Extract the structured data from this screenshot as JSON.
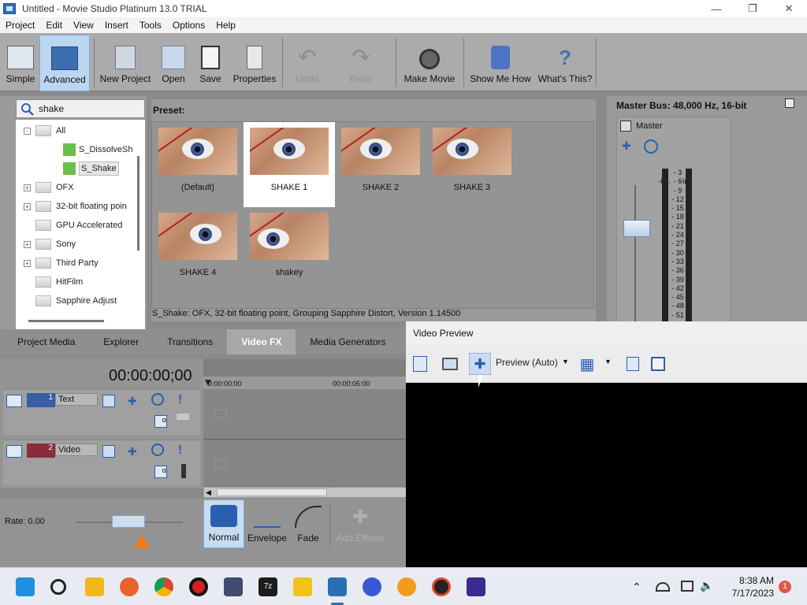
{
  "window": {
    "title": "Untitled - Movie Studio Platinum 13.0 TRIAL"
  },
  "menu": [
    "Project",
    "Edit",
    "View",
    "Insert",
    "Tools",
    "Options",
    "Help"
  ],
  "toolbar": {
    "simple": "Simple",
    "advanced": "Advanced",
    "new_project": "New Project",
    "open": "Open",
    "save": "Save",
    "properties": "Properties",
    "undo": "Undo",
    "redo": "Redo",
    "make_movie": "Make Movie",
    "show_me_how": "Show Me How",
    "whats_this": "What's This?"
  },
  "search": {
    "query": "shake"
  },
  "tree": {
    "items": [
      {
        "label": "All",
        "kind": "folder",
        "expand": "-"
      },
      {
        "label": "S_DissolveSh",
        "kind": "fx"
      },
      {
        "label": "S_Shake",
        "kind": "fx",
        "selected": true
      },
      {
        "label": "OFX",
        "kind": "folder",
        "expand": "+"
      },
      {
        "label": "32-bit floating poin",
        "kind": "folder",
        "expand": "+"
      },
      {
        "label": "GPU Accelerated",
        "kind": "folder"
      },
      {
        "label": "Sony",
        "kind": "folder",
        "expand": "+"
      },
      {
        "label": "Third Party",
        "kind": "folder",
        "expand": "+"
      },
      {
        "label": "HitFilm",
        "kind": "folder"
      },
      {
        "label": "Sapphire Adjust",
        "kind": "folder"
      }
    ]
  },
  "preset": {
    "title": "Preset:",
    "items": [
      "(Default)",
      "SHAKE 1",
      "SHAKE 2",
      "SHAKE 3",
      "SHAKE 4",
      "shakey"
    ],
    "selected": "SHAKE 1",
    "status": "S_Shake: OFX, 32-bit floating point, Grouping  Sapphire Distort, Version 1.14500"
  },
  "master": {
    "title": "Master Bus: 48,000 Hz, 16-bit",
    "channel": "Master",
    "peak_left": "-Inf.",
    "peak_right": "-Inf.",
    "scale": [
      "3",
      "6",
      "9",
      "12",
      "15",
      "18",
      "21",
      "24",
      "27",
      "30",
      "33",
      "36",
      "39",
      "42",
      "45",
      "48",
      "51"
    ]
  },
  "tabs": [
    "Project Media",
    "Explorer",
    "Transitions",
    "Video FX",
    "Media Generators"
  ],
  "active_tab": "Video FX",
  "timeline": {
    "timecode": "00:00:00;00",
    "ruler": [
      "0:00:00:00",
      "00:00:05:00"
    ],
    "tracks": [
      {
        "number": "1",
        "name": "Text"
      },
      {
        "number": "2",
        "name": "Video"
      }
    ]
  },
  "bottom": {
    "rate": "Rate: 0.00",
    "normal": "Normal",
    "envelope": "Envelope",
    "fade": "Fade",
    "add_effects": "Add Effects"
  },
  "preview": {
    "title": "Video Preview",
    "mode": "Preview (Auto)"
  },
  "taskbar": {
    "time": "8:38 AM",
    "date": "7/17/2023",
    "notifications": "1"
  }
}
